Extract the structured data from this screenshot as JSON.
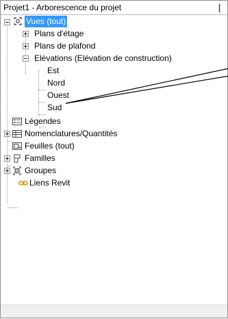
{
  "window": {
    "title": "Projet1 - Arborescence du projet",
    "title_tail": "["
  },
  "tree": {
    "vues": "Vues (tout)",
    "plans_etage": "Plans d'étage",
    "plans_plafond": "Plans de plafond",
    "elevations": "Elévations (Elévation de construction)",
    "est": "Est",
    "nord": "Nord",
    "ouest": "Ouest",
    "sud": "Sud",
    "legendes": "Légendes",
    "nomenclatures": "Nomenclatures/Quantités",
    "feuilles": "Feuilles (tout)",
    "familles": "Familles",
    "groupes": "Groupes",
    "liens": "Liens Revit"
  },
  "colors": {
    "selection": "#3399ff",
    "link_icon": "#e0a020"
  }
}
